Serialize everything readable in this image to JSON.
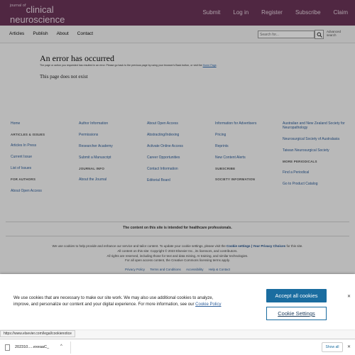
{
  "header": {
    "logo_small": "journal of",
    "logo_line1": "clinical",
    "logo_line2": "neuroscience",
    "nav": [
      "Submit",
      "Log in",
      "Register",
      "Subscribe",
      "Claim"
    ]
  },
  "subnav": {
    "links": [
      "Articles",
      "Publish",
      "About",
      "Contact"
    ],
    "search_placeholder": "Search for...",
    "advanced": "Advanced search"
  },
  "error": {
    "title": "An error has occurred",
    "message": "The page or action you requested has resulted in an error. Please go back to the previous page by using your browser's Back button, or visit the",
    "home_link": "Home Page",
    "not_found": "This page does not exist"
  },
  "footer": {
    "col1": [
      {
        "text": "Home",
        "type": "link"
      },
      {
        "text": "ARTICLES & ISSUES",
        "type": "head"
      },
      {
        "text": "Articles In Press",
        "type": "link"
      },
      {
        "text": "Current Issue",
        "type": "link"
      },
      {
        "text": "List of Issues",
        "type": "link"
      },
      {
        "text": "FOR AUTHORS",
        "type": "head"
      },
      {
        "text": "About Open Access",
        "type": "link"
      }
    ],
    "col2": [
      {
        "text": "Author Information",
        "type": "link"
      },
      {
        "text": "Permissions",
        "type": "link"
      },
      {
        "text": "Researcher Academy",
        "type": "link"
      },
      {
        "text": "Submit a Manuscript",
        "type": "link"
      },
      {
        "text": "JOURNAL INFO",
        "type": "head"
      },
      {
        "text": "About the Journal",
        "type": "link"
      }
    ],
    "col3": [
      {
        "text": "About Open Access",
        "type": "link"
      },
      {
        "text": "Abstracting/Indexing",
        "type": "link"
      },
      {
        "text": "Activate Online Access",
        "type": "link"
      },
      {
        "text": "Career Opportunities",
        "type": "link"
      },
      {
        "text": "Contact Information",
        "type": "link"
      },
      {
        "text": "Editorial Board",
        "type": "link"
      }
    ],
    "col4": [
      {
        "text": "Information for Advertisers",
        "type": "link"
      },
      {
        "text": "Pricing",
        "type": "link"
      },
      {
        "text": "Reprints",
        "type": "link"
      },
      {
        "text": "New Content Alerts",
        "type": "link"
      },
      {
        "text": "SUBSCRIBE",
        "type": "head"
      },
      {
        "text": "SOCIETY INFORMATION",
        "type": "head"
      }
    ],
    "col5": [
      {
        "text": "Australian and New Zealand Society for Neuropathology",
        "type": "link"
      },
      {
        "text": "Neurosurgical Society of Australasia",
        "type": "link"
      },
      {
        "text": "Taiwan Neurosurgical Society",
        "type": "link"
      },
      {
        "text": "MORE PERIODICALS",
        "type": "head"
      },
      {
        "text": "Find a Periodical",
        "type": "link"
      },
      {
        "text": "Go to Product Catalog",
        "type": "link"
      }
    ],
    "healthcare_notice": "The content on this site is intended for healthcare professionals.",
    "copy_line1_pre": "We use cookies to help provide and enhance our service and tailor content. To update your cookie settings, please visit the",
    "copy_cookie_settings": "Cookie settings | Your Privacy Choices",
    "copy_line1_post": "for this site.",
    "copy_line2": "All content on this site: Copyright © 2023 Elsevier Inc., its licensors, and contributors.",
    "copy_line3": "All rights are reserved, including those for text and data mining, AI training, and similar technologies.",
    "copy_line4": "For all open access content, the Creative Commons licensing terms apply.",
    "legal_links": [
      "Privacy Policy",
      "Terms and Conditions",
      "Accessibility",
      "Help & Contact"
    ]
  },
  "cookie_banner": {
    "text": "We use cookies that are necessary to make our site work. We may also use additional cookies to analyze, improve, and personalize our content and your digital experience. For more information, see our",
    "policy_link": "Cookie Policy",
    "accept": "Accept all cookies",
    "settings": "Cookie Settings",
    "close": "✕"
  },
  "status_url": "https://www.elsevier.com/legal/cookienotice",
  "download_bar": {
    "filename": "202310.....exeaaC_",
    "caret": "^",
    "show_all": "Show all",
    "close": "✕"
  }
}
